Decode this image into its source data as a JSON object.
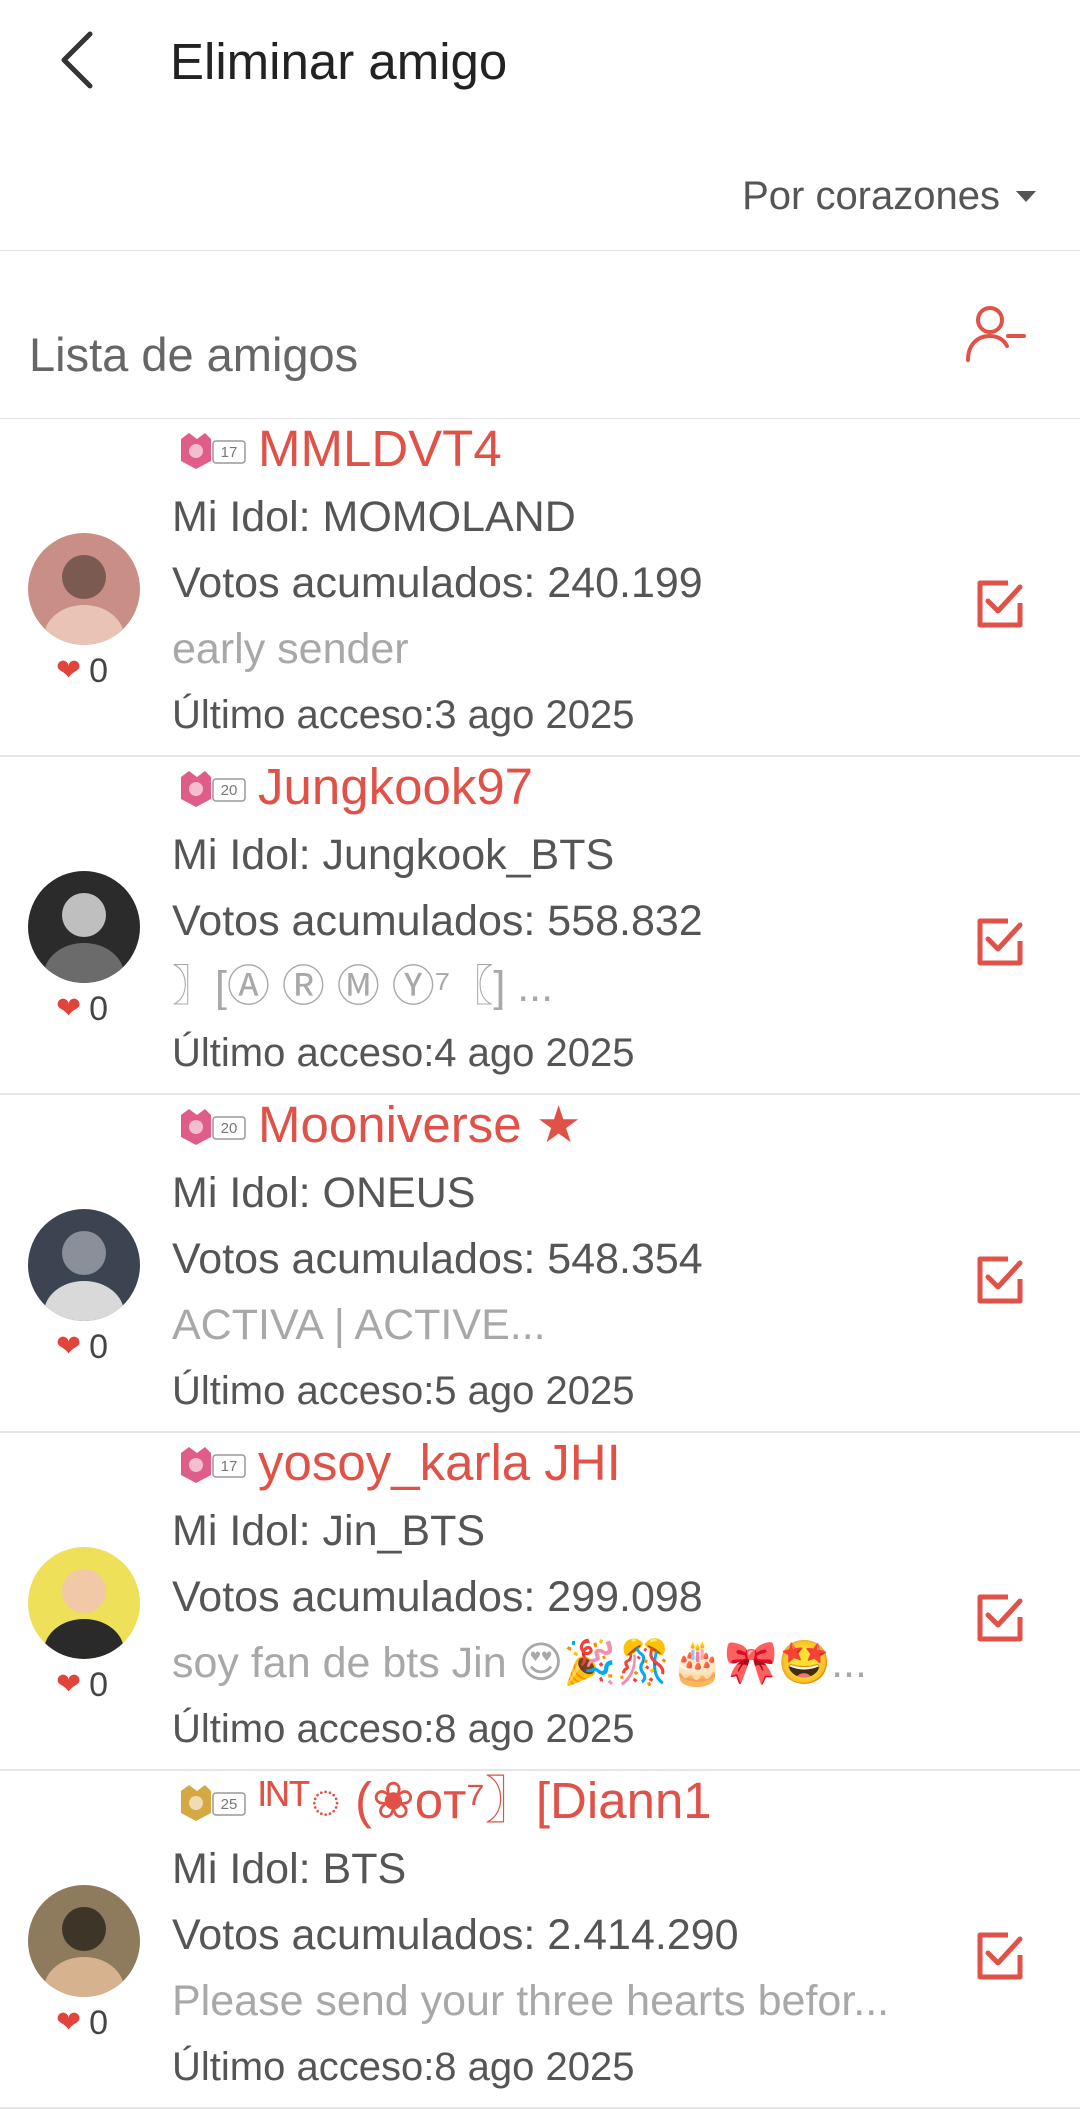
{
  "header": {
    "title": "Eliminar amigo"
  },
  "sort": {
    "label": "Por corazones"
  },
  "list": {
    "title": "Lista de amigos"
  },
  "friends": [
    {
      "badge_level": "17",
      "badge_color": "#e05d8a",
      "name": "MMLDVT4",
      "idol": "Mi Idol: MOMOLAND",
      "votes": "Votos acumulados: 240.199",
      "status": "early sender",
      "last_access": "Último acceso:3 ago 2025",
      "hearts": "0",
      "avatar_colors": [
        "#c98f86",
        "#e8c3b6",
        "#7b5a52"
      ]
    },
    {
      "badge_level": "20",
      "badge_color": "#e05d8a",
      "name": "Jungkook97",
      "idol": "Mi Idol: Jungkook_BTS",
      "votes": "Votos acumulados: 558.832",
      "status": "〗[Ⓐ Ⓡ Ⓜ Ⓨ⁷〖] ...",
      "last_access": "Último acceso:4 ago 2025",
      "hearts": "0",
      "avatar_colors": [
        "#2b2b2b",
        "#6b6b6b",
        "#bfbfbf"
      ]
    },
    {
      "badge_level": "20",
      "badge_color": "#e05d8a",
      "name": "Mooniverse ★",
      "idol": "Mi Idol: ONEUS",
      "votes": "Votos acumulados: 548.354",
      "status": "ACTIVA | ACTIVE...",
      "last_access": "Último acceso:5 ago 2025",
      "hearts": "0",
      "avatar_colors": [
        "#3c4452",
        "#d9d9d9",
        "#8a8f99"
      ]
    },
    {
      "badge_level": "17",
      "badge_color": "#e05d8a",
      "name": "yosoy_karla JHI",
      "idol": "Mi Idol: Jin_BTS",
      "votes": "Votos acumulados: 299.098",
      "status": "soy fan de bts Jin 😍🎉🎊🎂🎀🤩...",
      "last_access": "Último acceso:8 ago 2025",
      "hearts": "0",
      "avatar_colors": [
        "#efe05a",
        "#2a2a2a",
        "#f1c9a8"
      ]
    },
    {
      "badge_level": "25",
      "badge_color": "#d4a843",
      "name": "ᴵᴺᵀ◌ (❀ᴏᴛ⁷〗[Diann1",
      "idol": "Mi Idol: BTS",
      "votes": "Votos acumulados: 2.414.290",
      "status": "Please send your three hearts befor...",
      "last_access": "Último acceso:8 ago 2025",
      "hearts": "0",
      "avatar_colors": [
        "#8e7a5c",
        "#d7b28f",
        "#3d3528"
      ]
    }
  ],
  "colors": {
    "accent": "#e05248",
    "heart": "#e0443a"
  },
  "icons": {
    "back": "chevron-left-icon",
    "remove_user": "user-minus-icon",
    "check": "checkbox-checked-icon",
    "heart": "heart-icon"
  }
}
